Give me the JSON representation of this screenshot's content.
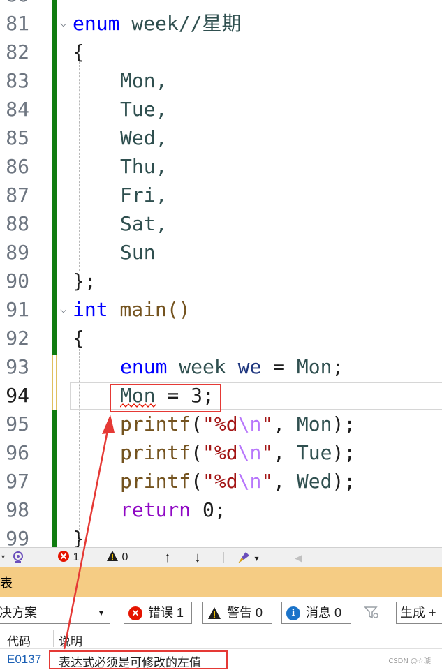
{
  "editor": {
    "partial_top_line": "80",
    "partial_bottom_line": "99",
    "lines": [
      {
        "num": "81",
        "text_kw": "enum",
        "text_rest": " week//星期"
      },
      {
        "num": "82",
        "text": "{"
      },
      {
        "num": "83",
        "text": "Mon,"
      },
      {
        "num": "84",
        "text": "Tue,"
      },
      {
        "num": "85",
        "text": "Wed,"
      },
      {
        "num": "86",
        "text": "Thu,"
      },
      {
        "num": "87",
        "text": "Fri,"
      },
      {
        "num": "88",
        "text": "Sat,"
      },
      {
        "num": "89",
        "text": "Sun"
      },
      {
        "num": "90",
        "text": "};"
      },
      {
        "num": "91",
        "text_kw": "int",
        "text_rest": " main()"
      },
      {
        "num": "92",
        "text": "{"
      },
      {
        "num": "93",
        "kw": "enum",
        "type": "week",
        "var": "we",
        "eq": " = ",
        "val": "Mon",
        "end": ";"
      },
      {
        "num": "94",
        "enumerator": "Mon",
        "rest": " = 3;"
      },
      {
        "num": "95",
        "fn": "printf",
        "open": "(",
        "q1": "\"",
        "fmt": "%d",
        "esc": "\\n",
        "q2": "\"",
        "sep": ", ",
        "arg": "Mon",
        "close": ");"
      },
      {
        "num": "96",
        "fn": "printf",
        "open": "(",
        "q1": "\"",
        "fmt": "%d",
        "esc": "\\n",
        "q2": "\"",
        "sep": ", ",
        "arg": "Tue",
        "close": ");"
      },
      {
        "num": "97",
        "fn": "printf",
        "open": "(",
        "q1": "\"",
        "fmt": "%d",
        "esc": "\\n",
        "q2": "\"",
        "sep": ", ",
        "arg": "Wed",
        "close": ");"
      },
      {
        "num": "98",
        "kw": "return",
        "rest": " 0;"
      }
    ],
    "last_partial_code": "}"
  },
  "status": {
    "errors": "1",
    "warnings": "0"
  },
  "error_list": {
    "title": "表",
    "scope_value": "决方案",
    "errors_btn": "错误 1",
    "warnings_btn": "警告 0",
    "messages_btn": "消息 0",
    "build_value": "生成 +",
    "col_code": "代码",
    "col_desc": "说明",
    "rows": [
      {
        "code": "E0137",
        "desc": "表达式必须是可修改的左值"
      }
    ]
  },
  "watermark": "CSDN @☆璇",
  "colors": {
    "keyword": "#0000ff",
    "enum_member": "#2f4f4f",
    "function": "#74531f",
    "string": "#a31515",
    "escape": "#b776fb",
    "control_keyword": "#8f08c4",
    "change_bar": "#107c10",
    "panel_title_bg": "#f5cc84",
    "annotation_red": "#e53935"
  }
}
